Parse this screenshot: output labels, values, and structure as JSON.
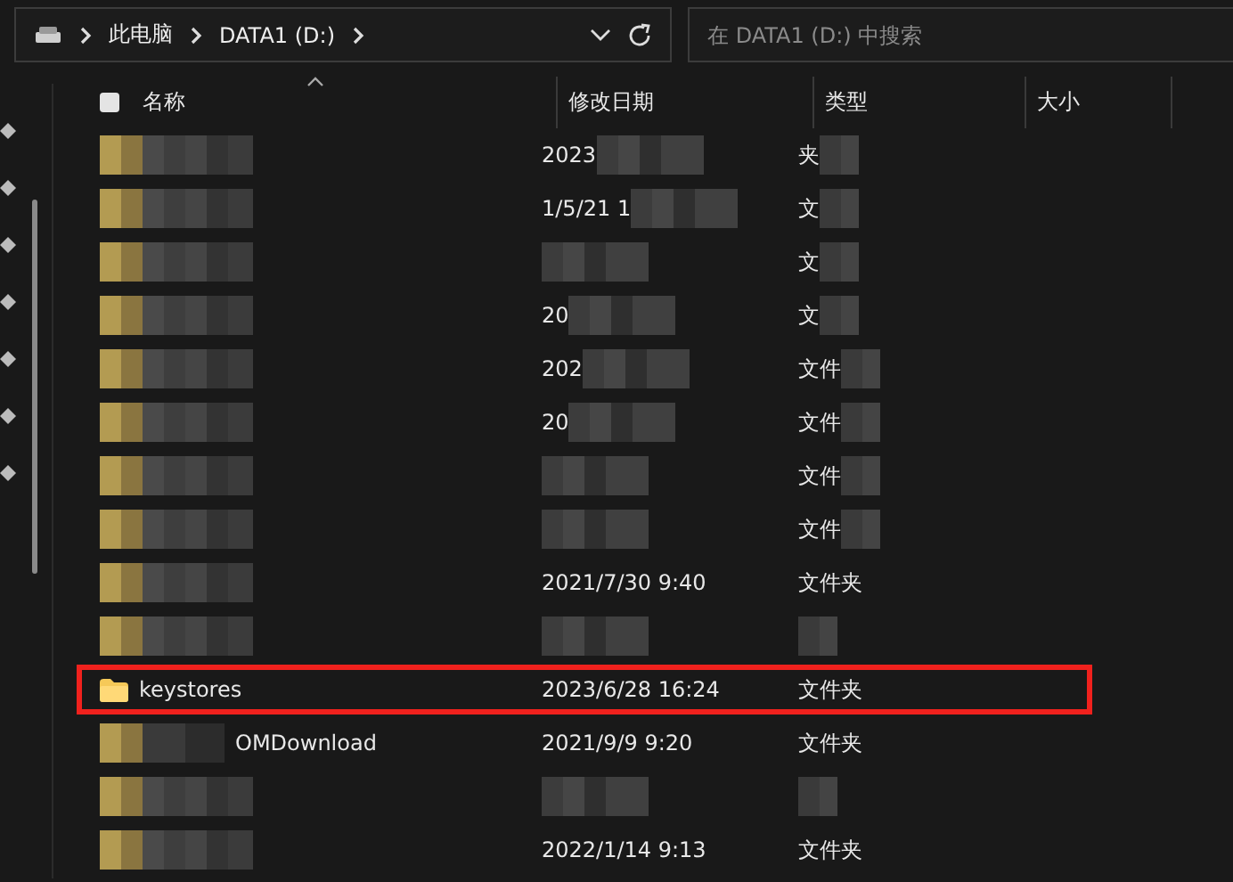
{
  "address_bar": {
    "crumbs": [
      "此电脑",
      "DATA1 (D:)"
    ]
  },
  "search": {
    "placeholder": "在 DATA1 (D:) 中搜索"
  },
  "select_all": {
    "checked": false
  },
  "columns": [
    "名称",
    "修改日期",
    "类型",
    "大小"
  ],
  "rows": [
    {
      "name_masked": true,
      "date": "2023",
      "date_masked": true,
      "type": "夹",
      "type_masked": true,
      "highlighted": false
    },
    {
      "name_masked": true,
      "date": "1/5/21 1",
      "date_masked": true,
      "type": "文",
      "type_masked": true,
      "highlighted": false
    },
    {
      "name_masked": true,
      "date_masked": true,
      "type": "文",
      "type_masked": true,
      "highlighted": false
    },
    {
      "name_masked": true,
      "date": "20",
      "date_masked": true,
      "type": "文",
      "type_masked": true,
      "highlighted": false
    },
    {
      "name_masked": true,
      "date": "202",
      "date_masked": true,
      "type": "文件",
      "type_masked": true,
      "highlighted": false
    },
    {
      "name_masked": true,
      "date": "20",
      "date_masked": true,
      "type": "文件",
      "type_masked": true,
      "highlighted": false
    },
    {
      "name_masked": true,
      "date_masked": true,
      "type": "文件",
      "type_masked": true,
      "highlighted": false
    },
    {
      "name_masked": true,
      "date_masked": true,
      "type": "文件",
      "type_masked": true,
      "highlighted": false
    },
    {
      "name_masked": true,
      "date": "2021/7/30 9:40",
      "date_masked": false,
      "type": "文件夹",
      "type_masked": false,
      "highlighted": false
    },
    {
      "name_masked": true,
      "date_masked": true,
      "type_masked": true,
      "highlighted": false
    },
    {
      "name": "keystores",
      "name_masked": false,
      "date": "2023/6/28 16:24",
      "date_masked": false,
      "type": "文件夹",
      "type_masked": false,
      "highlighted": true
    },
    {
      "name": "OMDownload",
      "name_masked": true,
      "date": "2021/9/9 9:20",
      "date_masked": false,
      "type": "文件夹",
      "type_masked": false,
      "highlighted": false
    },
    {
      "name_masked": true,
      "date_masked": true,
      "type_masked": true,
      "highlighted": false
    },
    {
      "name_masked": true,
      "date": "2022/1/14 9:13",
      "date_masked": false,
      "type": "文件夹",
      "type_masked": false,
      "highlighted": false
    }
  ]
}
